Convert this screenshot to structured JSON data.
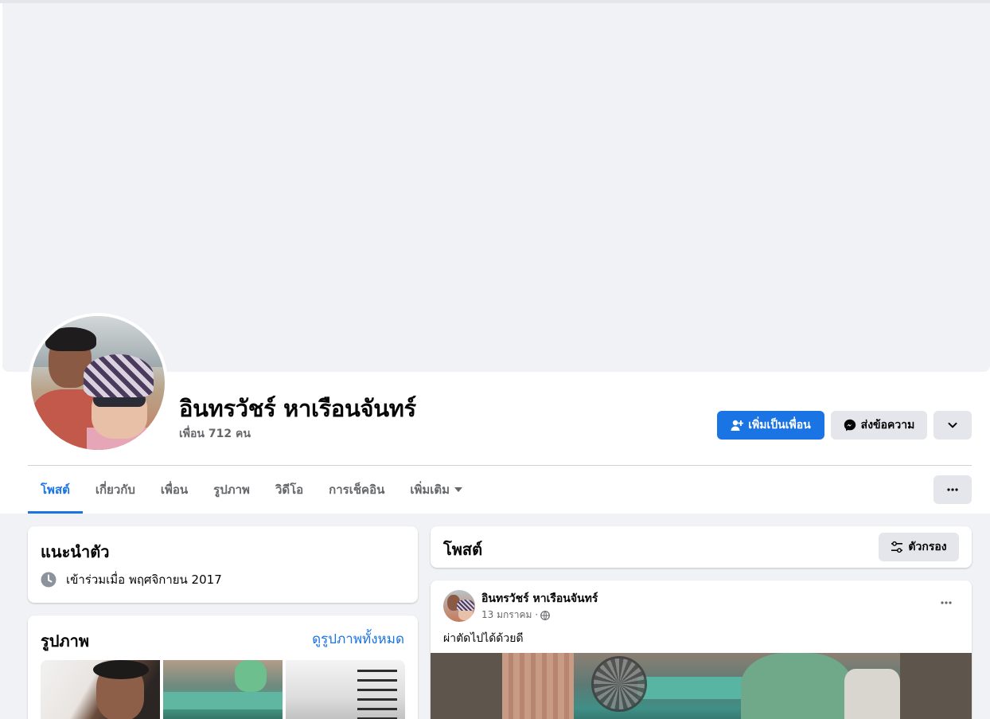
{
  "profile": {
    "name": "อินทรวัชร์ หาเรือนจันทร์",
    "friends_text": "เพื่อน 712 คน"
  },
  "actions": {
    "add_friend": "เพิ่มเป็นเพื่อน",
    "message": "ส่งข้อความ"
  },
  "tabs": [
    {
      "label": "โพสต์",
      "active": true
    },
    {
      "label": "เกี่ยวกับ"
    },
    {
      "label": "เพื่อน"
    },
    {
      "label": "รูปภาพ"
    },
    {
      "label": "วิดีโอ"
    },
    {
      "label": "การเช็คอิน"
    },
    {
      "label": "เพิ่มเติม"
    }
  ],
  "intro": {
    "title": "แนะนำตัว",
    "joined": "เข้าร่วมเมื่อ พฤศจิกายน 2017"
  },
  "photos": {
    "title": "รูปภาพ",
    "see_all": "ดูรูปภาพทั้งหมด"
  },
  "posts": {
    "title": "โพสต์",
    "filter": "ตัวกรอง"
  },
  "post": {
    "author": "อินทรวัชร์ หาเรือนจันทร์",
    "date": "13 มกราคม ·",
    "text": "ผ่าตัดไปได้ด้วยดี"
  },
  "colors": {
    "primary": "#1b74e4",
    "background": "#f0f2f5",
    "secondary_button": "#e4e6eb",
    "muted_text": "#65676b"
  }
}
